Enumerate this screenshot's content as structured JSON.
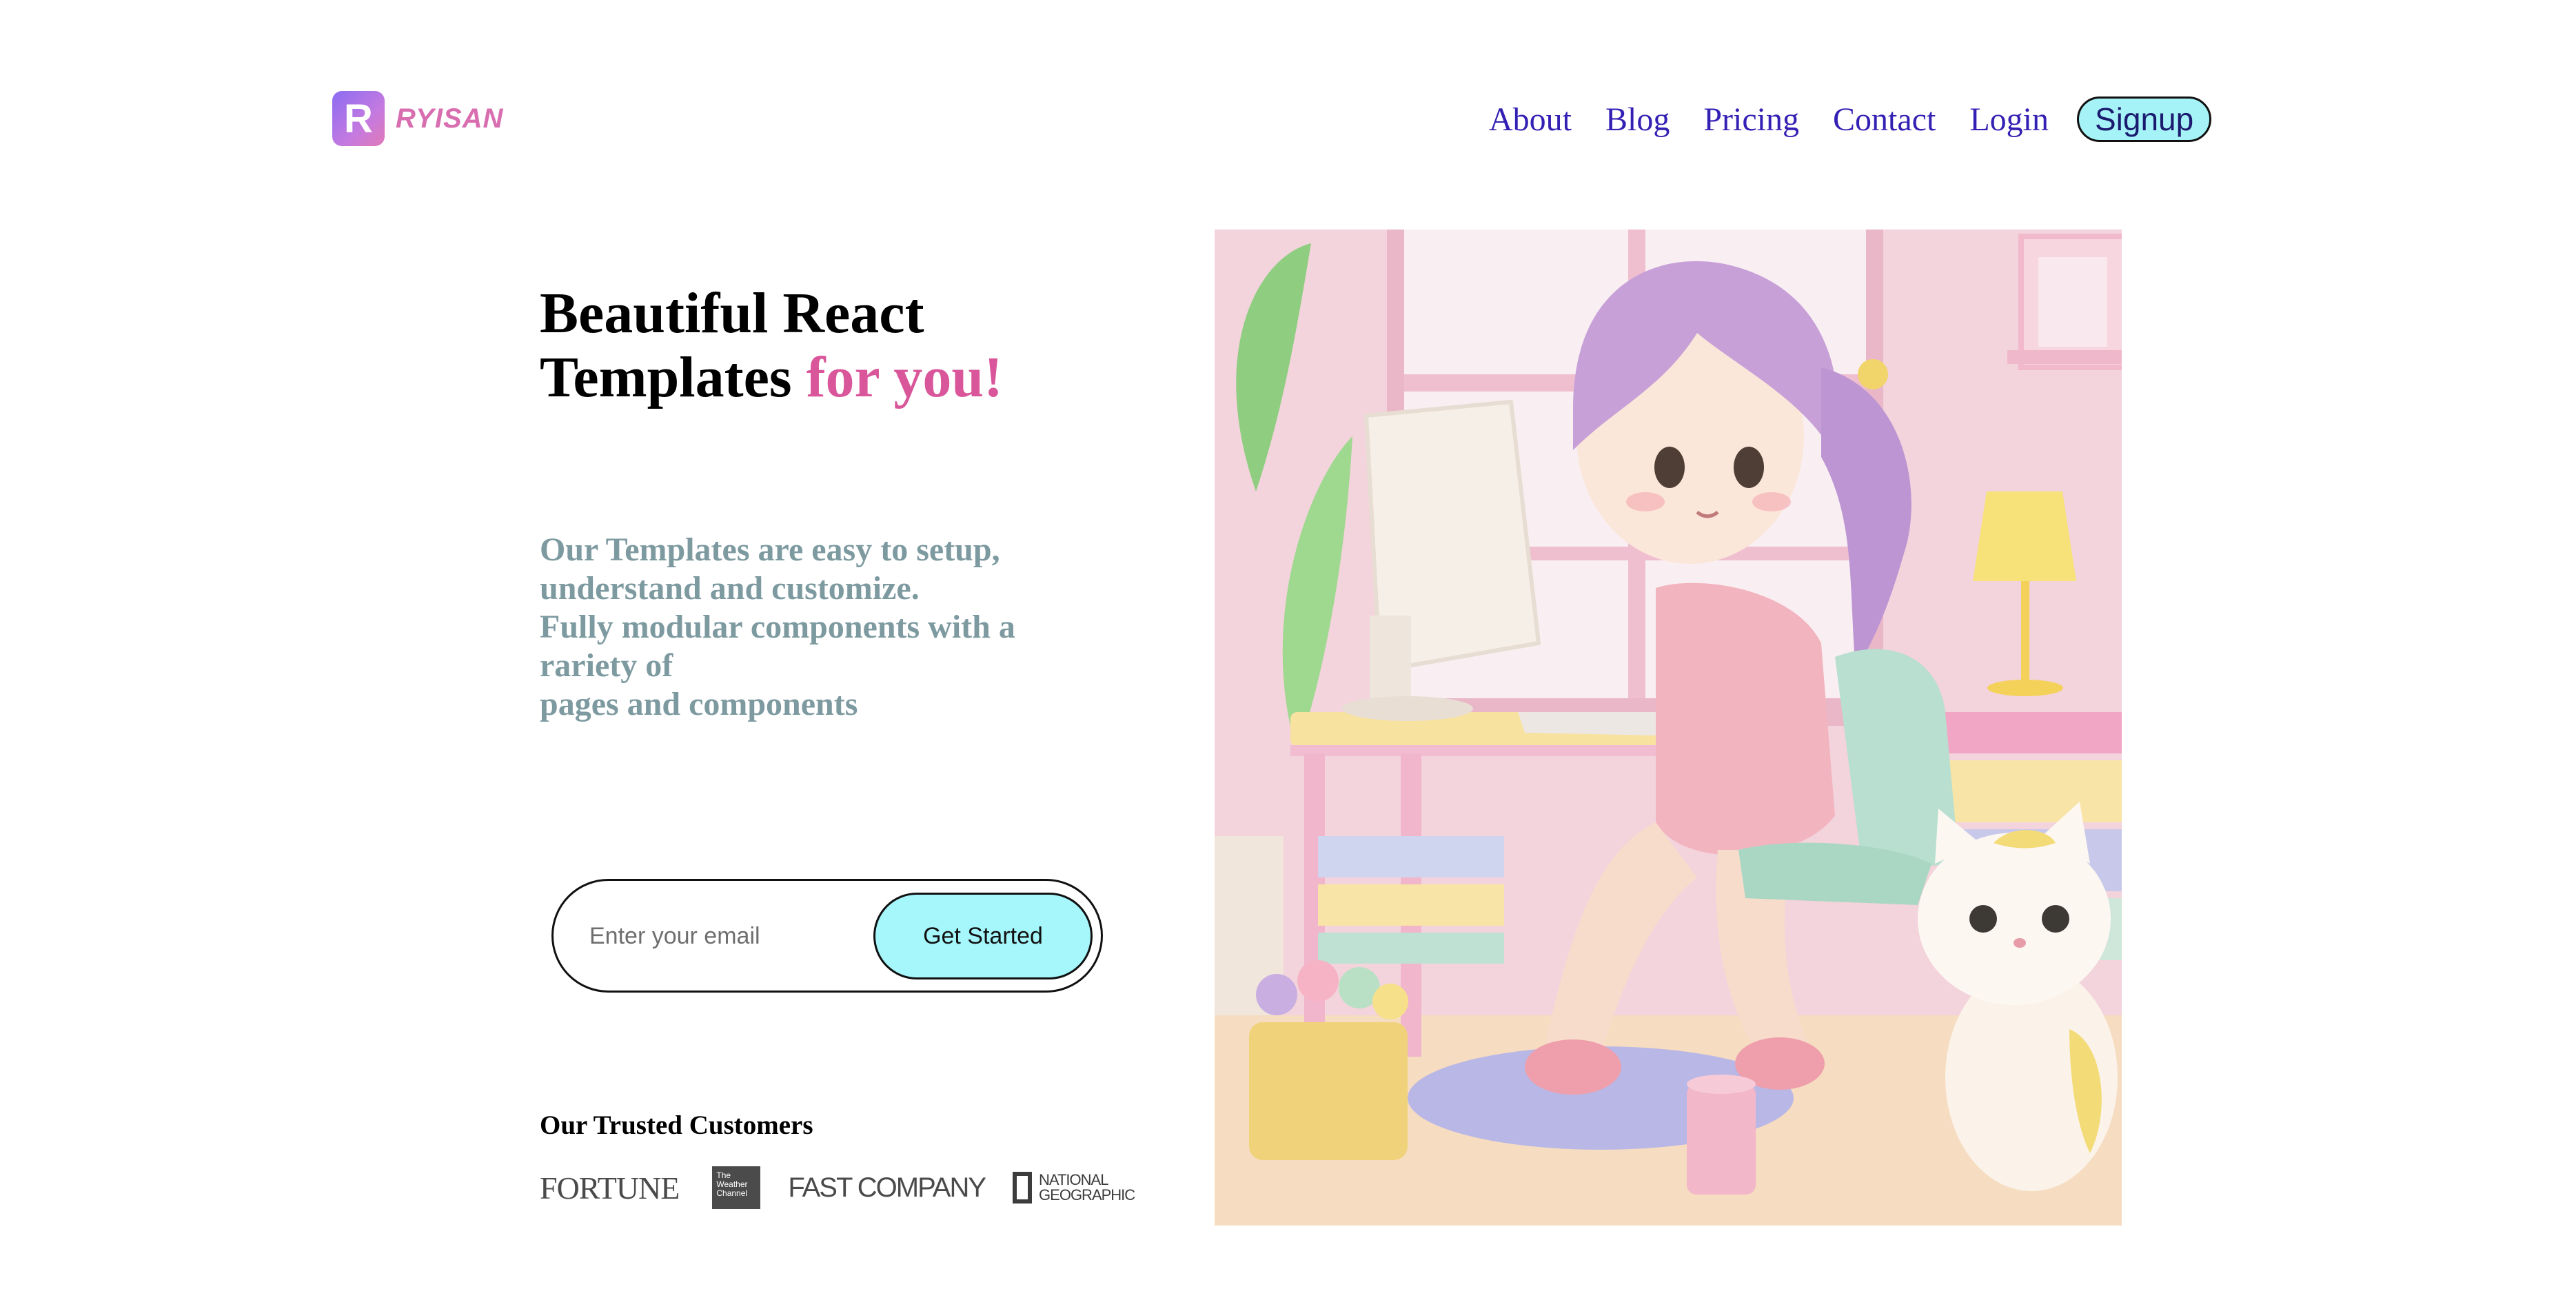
{
  "header": {
    "logo_letter": "R",
    "logo_text": "RYISAN",
    "nav": [
      "About",
      "Blog",
      "Pricing",
      "Contact",
      "Login"
    ],
    "signup_label": "Signup"
  },
  "hero": {
    "title_line1": "Beautiful React",
    "title_line2": "Templates ",
    "title_accent": "for you!",
    "description": [
      "Our Templates are easy to setup,",
      "understand and customize.",
      "Fully modular components with a",
      "rariety of",
      "pages and components"
    ]
  },
  "email_form": {
    "placeholder": "Enter your email",
    "button_label": "Get Started"
  },
  "trusted": {
    "title": "Our Trusted Customers",
    "logos": {
      "fortune": "FORTUNE",
      "weather_line1": "The",
      "weather_line2": "Weather",
      "weather_line3": "Channel",
      "fastcompany": "FAST COMPANY",
      "natgeo_line1": "NATIONAL",
      "natgeo_line2": "GEOGRAPHIC"
    }
  },
  "colors": {
    "nav_link": "#3421b4",
    "accent_pink": "#d9569a",
    "description": "#7d9aa0",
    "button_cyan": "#a5f7fb"
  },
  "illustration": {
    "description_icon": "girl-at-desk-illustration"
  }
}
